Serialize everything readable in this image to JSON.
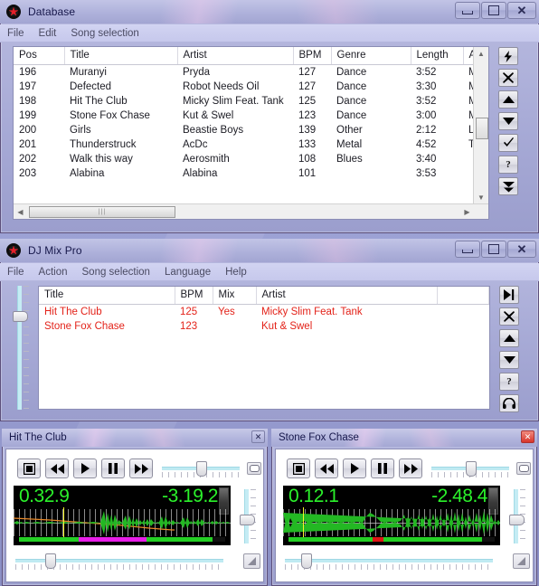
{
  "desktop": {
    "bg": "#9aa0d4"
  },
  "windows": {
    "database": {
      "title": "Database",
      "icon": "red-star-icon",
      "menus": [
        "File",
        "Edit",
        "Song selection"
      ],
      "titlebar_buttons": [
        {
          "name": "minimize-button",
          "glyph": "minimize"
        },
        {
          "name": "maximize-button",
          "glyph": "maximize"
        },
        {
          "name": "close-button",
          "glyph": "✕"
        }
      ],
      "table": {
        "columns": [
          "Pos",
          "Title",
          "Artist",
          "BPM",
          "Genre",
          "Length",
          "Al"
        ],
        "rows": [
          {
            "pos": "196",
            "title": "Muranyi",
            "artist": "Pryda",
            "bpm": "127",
            "genre": "Dance",
            "length": "3:52",
            "album": "M"
          },
          {
            "pos": "197",
            "title": "Defected",
            "artist": "Robot Needs Oil",
            "bpm": "127",
            "genre": "Dance",
            "length": "3:30",
            "album": "M"
          },
          {
            "pos": "198",
            "title": "Hit The Club",
            "artist": "Micky Slim Feat. Tank",
            "bpm": "125",
            "genre": "Dance",
            "length": "3:52",
            "album": "M"
          },
          {
            "pos": "199",
            "title": "Stone Fox Chase",
            "artist": "Kut & Swel",
            "bpm": "123",
            "genre": "Dance",
            "length": "3:00",
            "album": "M"
          },
          {
            "pos": "200",
            "title": "Girls",
            "artist": "Beastie Boys",
            "bpm": "139",
            "genre": "Other",
            "length": "2:12",
            "album": "Li"
          },
          {
            "pos": "201",
            "title": "Thunderstruck",
            "artist": "AcDc",
            "bpm": "133",
            "genre": "Metal",
            "length": "4:52",
            "album": "Th"
          },
          {
            "pos": "202",
            "title": "Walk this way",
            "artist": "Aerosmith",
            "bpm": "108",
            "genre": "Blues",
            "length": "3:40",
            "album": ""
          },
          {
            "pos": "203",
            "title": "Alabina",
            "artist": "Alabina",
            "bpm": "101",
            "genre": "",
            "length": "3:53",
            "album": ""
          }
        ]
      },
      "toolbar": [
        {
          "name": "auto-bpm-button",
          "icon": "lightning-bolt-icon"
        },
        {
          "name": "delete-button",
          "icon": "x-icon"
        },
        {
          "name": "move-up-button",
          "icon": "triangle-up-icon"
        },
        {
          "name": "move-down-button",
          "icon": "triangle-down-icon"
        },
        {
          "name": "confirm-button",
          "icon": "checkmark-icon"
        },
        {
          "name": "help-button",
          "icon": "question-mark-icon"
        },
        {
          "name": "send-to-list-button",
          "icon": "double-chevron-down-icon"
        }
      ]
    },
    "djmixpro": {
      "title": "DJ Mix Pro",
      "icon": "red-star-icon",
      "menus": [
        "File",
        "Action",
        "Song selection",
        "Language",
        "Help"
      ],
      "titlebar_buttons": [
        {
          "name": "minimize-button",
          "glyph": "minimize"
        },
        {
          "name": "maximize-button",
          "glyph": "maximize"
        },
        {
          "name": "close-button",
          "glyph": "✕"
        }
      ],
      "table": {
        "columns": [
          "Title",
          "BPM",
          "Mix",
          "Artist",
          ""
        ],
        "rows": [
          {
            "title": "Hit The Club",
            "bpm": "125",
            "mix": "Yes",
            "artist": "Micky Slim Feat. Tank"
          },
          {
            "title": "Stone Fox Chase",
            "bpm": "123",
            "mix": "",
            "artist": "Kut & Swel"
          }
        ]
      },
      "toolbar": [
        {
          "name": "skip-next-button",
          "icon": "skip-next-icon"
        },
        {
          "name": "delete-button",
          "icon": "x-icon"
        },
        {
          "name": "move-up-button",
          "icon": "triangle-up-icon"
        },
        {
          "name": "move-down-button",
          "icon": "triangle-down-icon"
        },
        {
          "name": "help-button",
          "icon": "question-mark-icon"
        },
        {
          "name": "headphones-button",
          "icon": "headphones-icon"
        }
      ],
      "crossfader": {
        "name": "playlist-crossfader",
        "value_pct": 22
      }
    },
    "player_left": {
      "title": "Hit The Club",
      "close_label": "✕",
      "close_active": false,
      "transport": [
        {
          "name": "stop-button",
          "icon": "stop-icon"
        },
        {
          "name": "rewind-button",
          "icon": "rewind-icon"
        },
        {
          "name": "play-button",
          "icon": "play-icon"
        },
        {
          "name": "pause-button",
          "icon": "pause-icon"
        },
        {
          "name": "fast-forward-button",
          "icon": "fast-forward-icon"
        }
      ],
      "pitch_slider": {
        "name": "pitch-slider",
        "value_pct": 50
      },
      "display": {
        "elapsed": "0.32.9",
        "remaining": "-3.19.2",
        "cursor_pct": 23,
        "progress": [
          {
            "color": "#24d024",
            "start_pct": 0,
            "width_pct": 29
          },
          {
            "color": "#e81ee8",
            "start_pct": 29,
            "width_pct": 33
          },
          {
            "color": "#24d024",
            "start_pct": 62,
            "width_pct": 32
          }
        ]
      },
      "volume_slider": {
        "name": "volume-slider",
        "value_pct": 55
      },
      "position_slider": {
        "name": "position-slider",
        "value_pct": 15
      },
      "aux_buttons": [
        {
          "name": "mute-button",
          "icon": "pill-icon"
        },
        {
          "name": "eq-button",
          "icon": "ramp-icon"
        },
        {
          "name": "cue-button",
          "icon": "ramp-icon"
        }
      ]
    },
    "player_right": {
      "title": "Stone Fox Chase",
      "close_label": "✕",
      "close_active": true,
      "transport": [
        {
          "name": "stop-button",
          "icon": "stop-icon"
        },
        {
          "name": "rewind-button",
          "icon": "rewind-icon"
        },
        {
          "name": "play-button",
          "icon": "play-icon"
        },
        {
          "name": "pause-button",
          "icon": "pause-icon"
        },
        {
          "name": "fast-forward-button",
          "icon": "fast-forward-icon"
        }
      ],
      "pitch_slider": {
        "name": "pitch-slider",
        "value_pct": 50
      },
      "display": {
        "elapsed": "0.12.1",
        "remaining": "-2.48.4",
        "cursor_pct": 9,
        "progress": [
          {
            "color": "#24d024",
            "start_pct": 0,
            "width_pct": 41
          },
          {
            "color": "#e01414",
            "start_pct": 41,
            "width_pct": 5
          },
          {
            "color": "#24d024",
            "start_pct": 46,
            "width_pct": 48
          }
        ]
      },
      "volume_slider": {
        "name": "volume-slider",
        "value_pct": 55
      },
      "position_slider": {
        "name": "position-slider",
        "value_pct": 8
      },
      "aux_buttons": [
        {
          "name": "mute-button",
          "icon": "pill-icon"
        },
        {
          "name": "eq-button",
          "icon": "ramp-icon"
        },
        {
          "name": "cue-button",
          "icon": "ramp-icon"
        }
      ]
    }
  }
}
